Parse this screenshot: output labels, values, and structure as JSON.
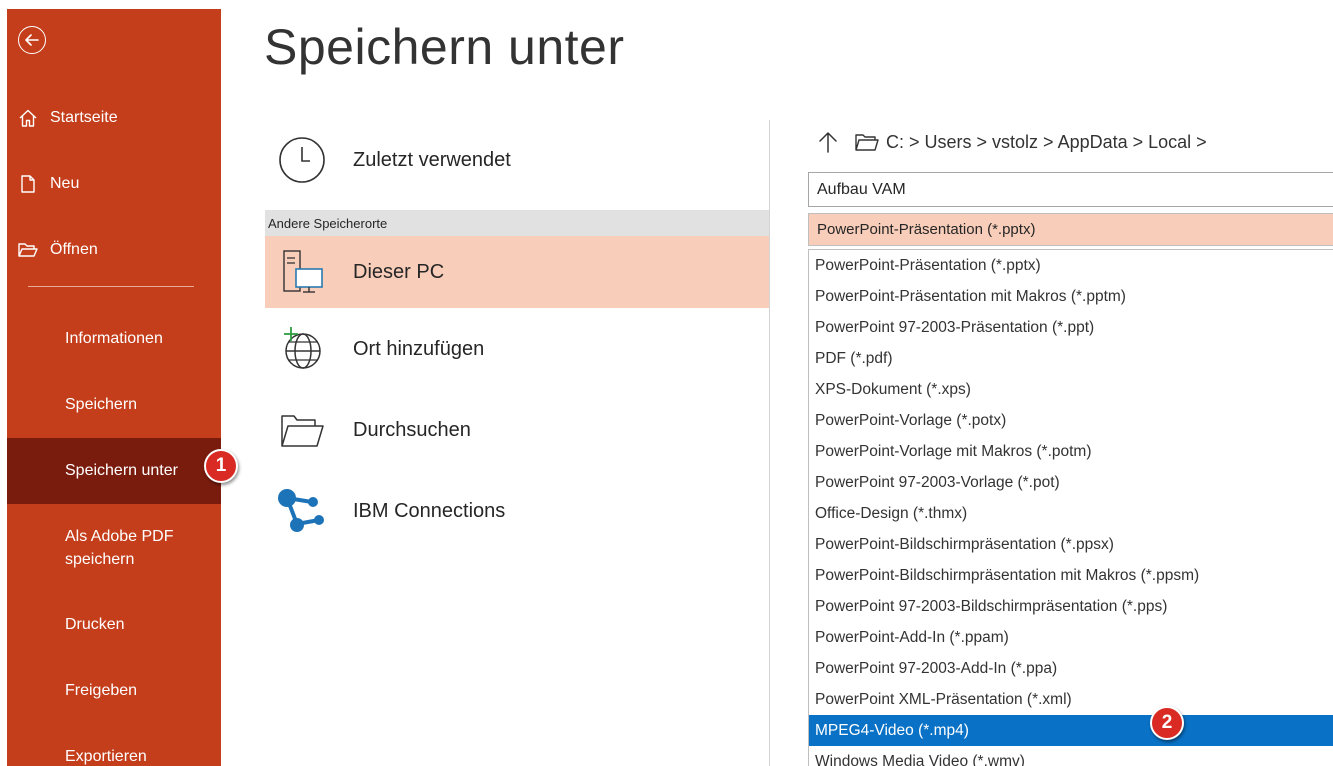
{
  "sidebar": {
    "back_icon": "back-arrow-icon",
    "top_items": [
      {
        "label": "Startseite",
        "icon": "home-icon"
      },
      {
        "label": "Neu",
        "icon": "new-document-icon"
      },
      {
        "label": "Öffnen",
        "icon": "open-folder-icon"
      }
    ],
    "items": [
      {
        "label": "Informationen"
      },
      {
        "label": "Speichern"
      },
      {
        "label": "Speichern unter",
        "active": true
      },
      {
        "label": "Als Adobe PDF speichern"
      },
      {
        "label": "Drucken"
      },
      {
        "label": "Freigeben"
      },
      {
        "label": "Exportieren"
      }
    ],
    "badge": "1"
  },
  "main": {
    "title": "Speichern unter",
    "recent": {
      "label": "Zuletzt verwendet",
      "icon": "clock-icon"
    },
    "section_header": "Andere Speicherorte",
    "places": [
      {
        "label": "Dieser PC",
        "icon": "computer-icon",
        "selected": true
      },
      {
        "label": "Ort hinzufügen",
        "icon": "add-place-globe-icon"
      },
      {
        "label": "Durchsuchen",
        "icon": "folder-icon"
      },
      {
        "label": "IBM Connections",
        "icon": "ibm-connections-icon"
      }
    ]
  },
  "save_pane": {
    "up_icon": "up-arrow-icon",
    "folder_icon": "folder-outline-icon",
    "path": "C: > Users > vstolz > AppData > Local >",
    "filename": "Aufbau VAM",
    "selected_type": "PowerPoint-Präsentation (*.pptx)",
    "file_types": [
      "PowerPoint-Präsentation (*.pptx)",
      "PowerPoint-Präsentation mit Makros (*.pptm)",
      "PowerPoint 97-2003-Präsentation (*.ppt)",
      "PDF (*.pdf)",
      "XPS-Dokument (*.xps)",
      "PowerPoint-Vorlage (*.potx)",
      "PowerPoint-Vorlage mit Makros (*.potm)",
      "PowerPoint 97-2003-Vorlage (*.pot)",
      "Office-Design (*.thmx)",
      "PowerPoint-Bildschirmpräsentation (*.ppsx)",
      "PowerPoint-Bildschirmpräsentation mit Makros (*.ppsm)",
      "PowerPoint 97-2003-Bildschirmpräsentation (*.pps)",
      "PowerPoint-Add-In (*.ppam)",
      "PowerPoint 97-2003-Add-In (*.ppa)",
      "PowerPoint XML-Präsentation (*.xml)",
      "MPEG4-Video (*.mp4)",
      "Windows Media Video (*.wmv)"
    ],
    "highlighted_index": 15,
    "badge": "2"
  },
  "colors": {
    "sidebar_bg": "#c43e1c",
    "sidebar_active": "#7a1c0d",
    "selected_place": "#f8cdb9",
    "highlight_blue": "#0a72c6",
    "badge_red": "#d92b23"
  }
}
